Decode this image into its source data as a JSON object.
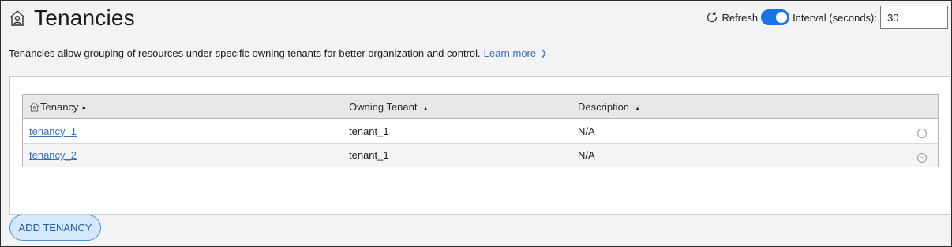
{
  "header": {
    "title": "Tenancies",
    "icon": "tenancy-home-icon"
  },
  "controls": {
    "refresh_label": "Refresh",
    "auto_refresh_on": true,
    "interval_label": "Interval (seconds):",
    "interval_value": "30"
  },
  "description": {
    "text": "Tenancies allow grouping of resources under specific owning tenants for better organization and control.",
    "learn_more": "Learn more"
  },
  "table": {
    "columns": [
      "Tenancy",
      "Owning Tenant",
      "Description"
    ],
    "sort_indicator": "▲",
    "rows": [
      {
        "tenancy": "tenancy_1",
        "owning_tenant": "tenant_1",
        "description": "N/A"
      },
      {
        "tenancy": "tenancy_2",
        "owning_tenant": "tenant_1",
        "description": "N/A"
      }
    ]
  },
  "actions": {
    "add_label": "ADD TENANCY"
  },
  "colors": {
    "accent": "#1a73e8",
    "link": "#3a6fb8",
    "button_bg": "#d3e8fb"
  }
}
